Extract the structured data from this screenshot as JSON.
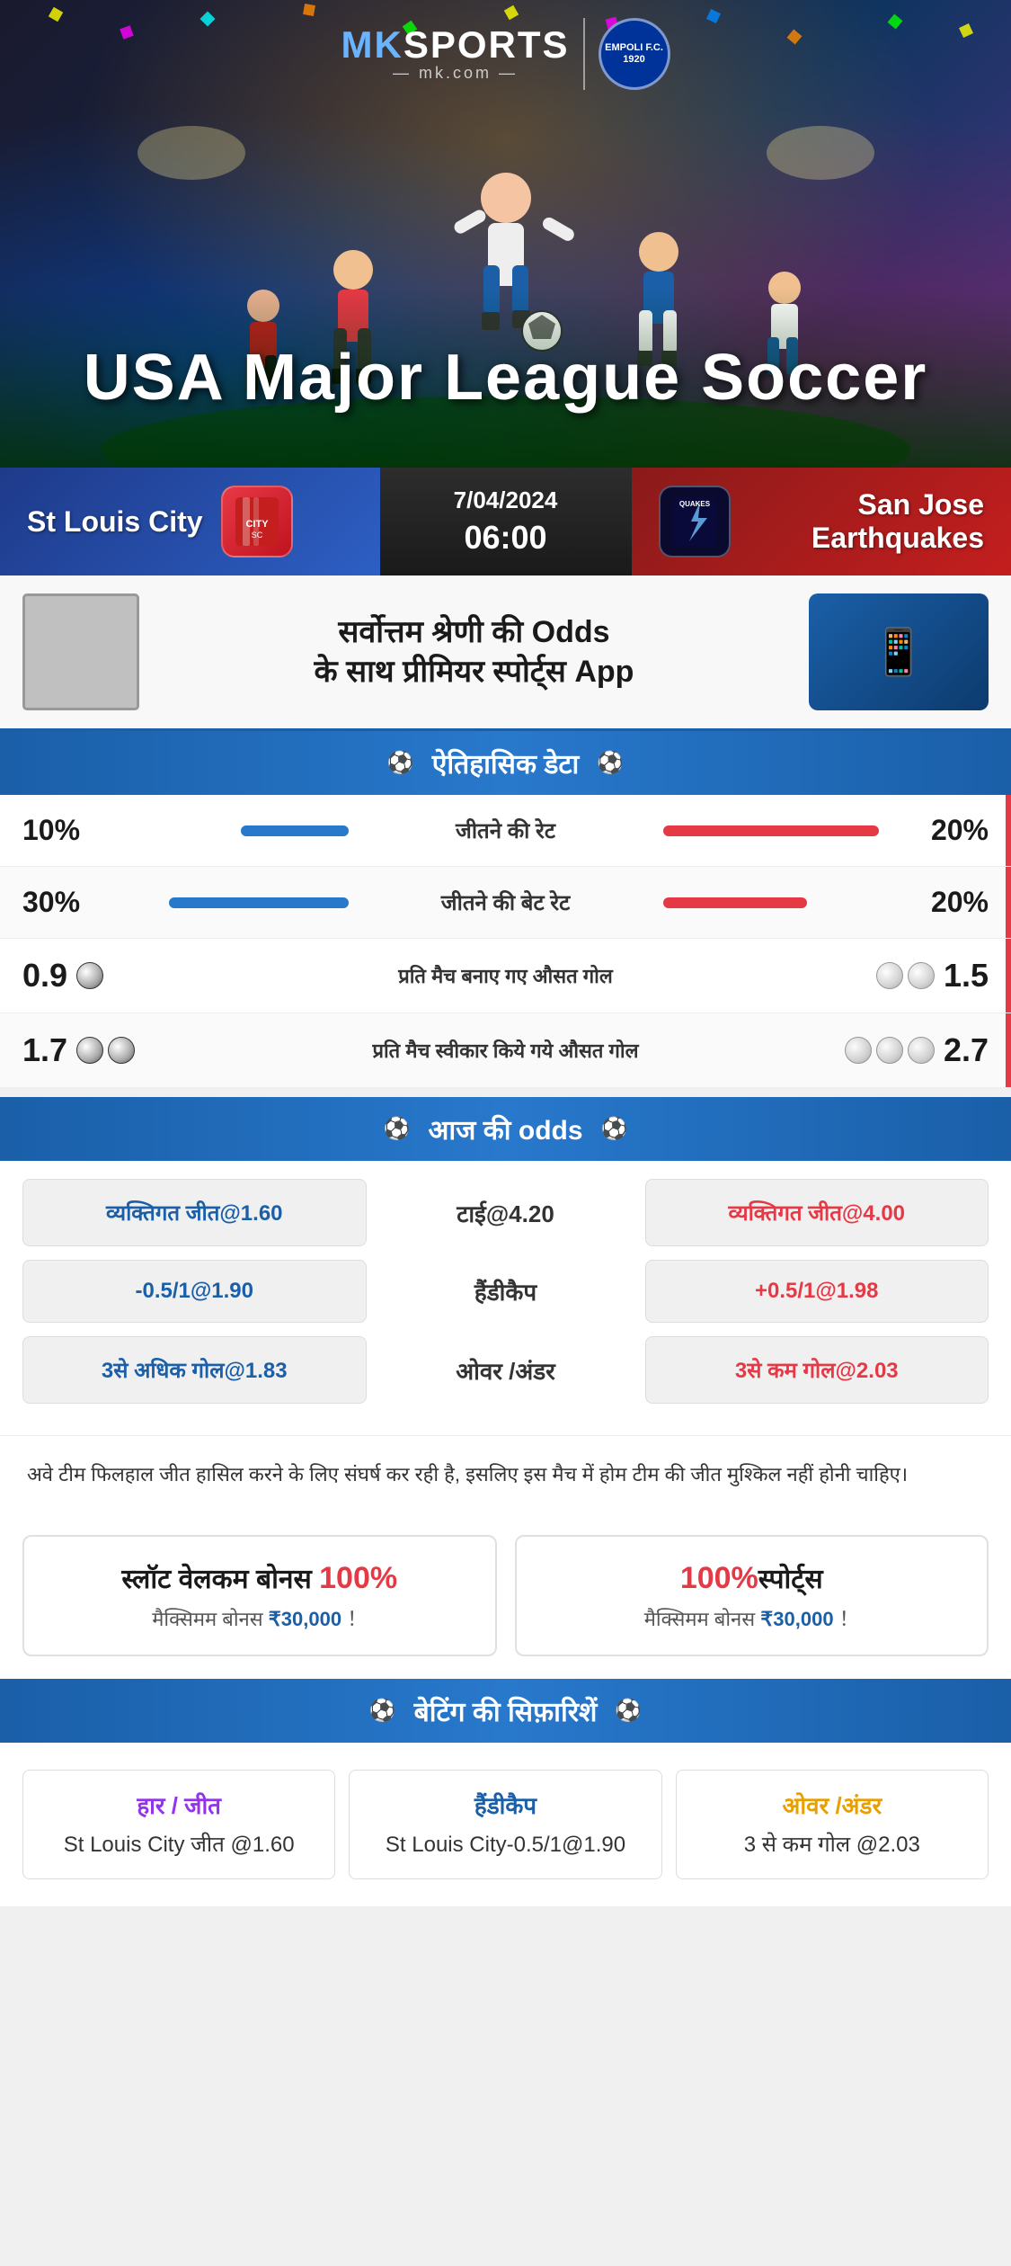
{
  "brand": {
    "name_mk": "MK",
    "name_sports": "SPORTS",
    "url": "— mk.com —",
    "partner_name": "EMPOLI F.C.",
    "partner_year": "1920"
  },
  "hero": {
    "title_line1": "USA Major League Soccer"
  },
  "match": {
    "home_team": "St Louis City",
    "away_team": "San Jose Earthquakes",
    "away_team_short": "QUAKES",
    "date": "7/04/2024",
    "time": "06:00"
  },
  "promo": {
    "text_line1": "सर्वोत्तम श्रेणी की Odds",
    "text_line2": "के साथ प्रीमियर स्पोर्ट्स App"
  },
  "historical_header": "ऐतिहासिक डेटा",
  "historical": {
    "win_rate_label": "जीतने की रेट",
    "win_rate_left": "10%",
    "win_rate_right": "20%",
    "win_rate_left_pct": 25,
    "win_rate_right_pct": 50,
    "bet_rate_label": "जीतने की बेट रेट",
    "bet_rate_left": "30%",
    "bet_rate_right": "20%",
    "bet_rate_left_pct": 60,
    "bet_rate_right_pct": 40,
    "avg_goals_label": "प्रति मैच बनाए गए औसत गोल",
    "avg_goals_left": "0.9",
    "avg_goals_right": "1.5",
    "avg_goals_left_balls": 1,
    "avg_goals_right_balls": 2,
    "avg_concede_label": "प्रति मैच स्वीकार किये गये औसत गोल",
    "avg_concede_left": "1.7",
    "avg_concede_right": "2.7",
    "avg_concede_left_balls": 2,
    "avg_concede_right_balls": 3
  },
  "odds_header": "आज की odds",
  "odds": {
    "personal_win_left": "व्यक्तिगत जीत@1.60",
    "tie": "टाई@4.20",
    "personal_win_right": "व्यक्तिगत जीत@4.00",
    "handicap_left": "-0.5/1@1.90",
    "handicap_label": "हैंडीकैप",
    "handicap_right": "+0.5/1@1.98",
    "over_left": "3से अधिक गोल@1.83",
    "over_label": "ओवर /अंडर",
    "over_right": "3से कम गोल@2.03"
  },
  "info_text": "अवे टीम फिलहाल जीत हासिल करने के लिए संघर्ष कर रही है, इसलिए इस मैच में होम टीम की जीत मुश्किल नहीं होनी चाहिए।",
  "bonus": {
    "card1_title": "स्लॉट वेलकम बोनस",
    "card1_percent": "100%",
    "card1_subtitle": "मैक्सिमम बोनस",
    "card1_amount": "₹30,000",
    "card1_exclaim": "！",
    "card2_title": "100%",
    "card2_title2": "स्पोर्ट्स",
    "card2_subtitle": "मैक्सिमम बोनस",
    "card2_amount": "₹30,000",
    "card2_exclaim": "！"
  },
  "betting_rec_header": "बेटिंग की सिफ़ारिशें",
  "betting_rec": {
    "col1_title": "हार / जीत",
    "col1_value": "St Louis City जीत @1.60",
    "col2_title": "हैंडीकैप",
    "col2_value": "St Louis City-0.5/1@1.90",
    "col3_title": "ओवर /अंडर",
    "col3_value": "3 से कम गोल @2.03"
  }
}
